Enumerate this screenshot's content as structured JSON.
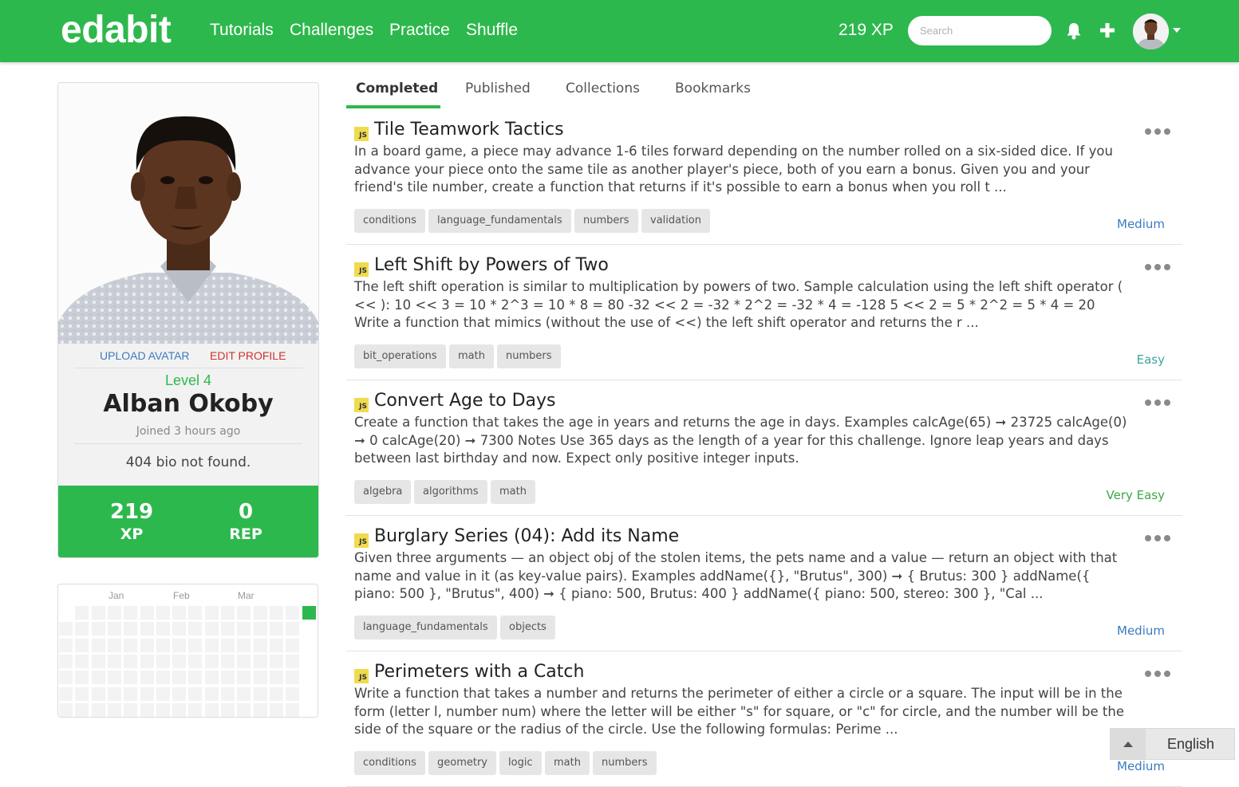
{
  "nav": {
    "logo": "edabit",
    "links": [
      "Tutorials",
      "Challenges",
      "Practice",
      "Shuffle"
    ],
    "xp": "219 XP",
    "search_placeholder": "Search"
  },
  "profile": {
    "upload_avatar": "UPLOAD AVATAR",
    "edit_profile": "EDIT PROFILE",
    "level": "Level 4",
    "name": "Alban Okoby",
    "joined": "Joined 3 hours ago",
    "bio": "404 bio not found.",
    "xp_value": "219",
    "xp_label": "XP",
    "rep_value": "0",
    "rep_label": "REP"
  },
  "calendar": {
    "months": [
      "Jan",
      "Feb",
      "Mar"
    ]
  },
  "tabs": [
    "Completed",
    "Published",
    "Collections",
    "Bookmarks"
  ],
  "challenges": [
    {
      "badge": "JS",
      "title": "Tile Teamwork Tactics",
      "description": "In a board game, a piece may advance 1-6 tiles forward depending on the number rolled on a six-sided dice. If you advance your piece onto the same tile as another player's piece, both of you earn a bonus. Given you and your friend's tile number, create a function that returns if it's possible to earn a bonus when you roll t ...",
      "tags": [
        "conditions",
        "language_fundamentals",
        "numbers",
        "validation"
      ],
      "difficulty": "Medium",
      "difficulty_color": "#3b7bbf"
    },
    {
      "badge": "JS",
      "title": "Left Shift by Powers of Two",
      "description": "The left shift operation is similar to multiplication by powers of two. Sample calculation using the left shift operator ( << ): 10 << 3 = 10 * 2^3 = 10 * 8 = 80 -32 << 2 = -32 * 2^2 = -32 * 4 = -128 5 << 2 = 5 * 2^2 = 5 * 4 = 20 Write a function that mimics (without the use of <<) the left shift operator and returns the r ...",
      "tags": [
        "bit_operations",
        "math",
        "numbers"
      ],
      "difficulty": "Easy",
      "difficulty_color": "#3aa6a0"
    },
    {
      "badge": "JS",
      "title": "Convert Age to Days",
      "description": "Create a function that takes the age in years and returns the age in days. Examples calcAge(65) ➞ 23725 calcAge(0) ➞ 0 calcAge(20) ➞ 7300 Notes Use 365 days as the length of a year for this challenge. Ignore leap years and days between last birthday and now. Expect only positive integer inputs.",
      "tags": [
        "algebra",
        "algorithms",
        "math"
      ],
      "difficulty": "Very Easy",
      "difficulty_color": "#3aa84a"
    },
    {
      "badge": "JS",
      "title": "Burglary Series (04): Add its Name",
      "description": "Given three arguments — an object obj of the stolen items, the pets name and a value — return an object with that name and value in it (as key-value pairs). Examples addName({}, \"Brutus\", 300) ➞ { Brutus: 300 } addName({ piano: 500 }, \"Brutus\", 400) ➞ { piano: 500, Brutus: 400 } addName({ piano: 500, stereo: 300 }, \"Cal ...",
      "tags": [
        "language_fundamentals",
        "objects"
      ],
      "difficulty": "Medium",
      "difficulty_color": "#3b7bbf"
    },
    {
      "badge": "JS",
      "title": "Perimeters with a Catch",
      "description": "Write a function that takes a number and returns the perimeter of either a circle or a square. The input will be in the form (letter l, number num) where the letter will be either \"s\" for square, or \"c\" for circle, and the number will be the side of the square or the radius of the circle. Use the following formulas: Perime ...",
      "tags": [
        "conditions",
        "geometry",
        "logic",
        "math",
        "numbers"
      ],
      "difficulty": "Medium",
      "difficulty_color": "#3b7bbf"
    }
  ],
  "language": {
    "label": "English"
  },
  "colors": {
    "brand": "#2db84d"
  }
}
